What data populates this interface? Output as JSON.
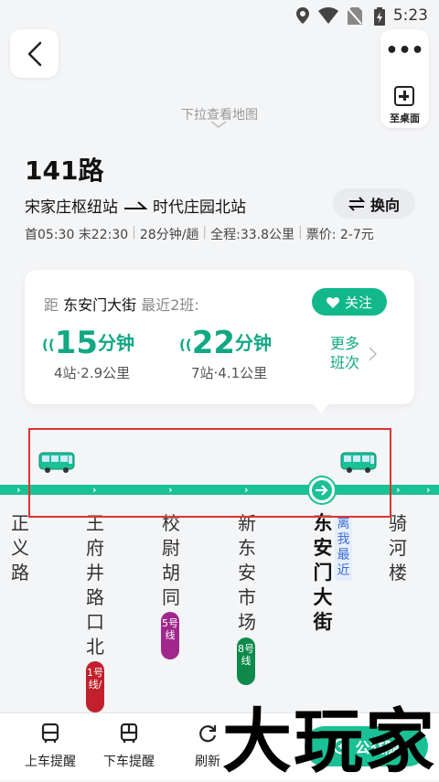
{
  "status_bar": {
    "time": "5:23"
  },
  "header": {
    "pull_hint": "下拉查看地图",
    "desktop_label": "至桌面"
  },
  "route": {
    "name": "141路",
    "from": "宋家庄枢纽站",
    "to": "时代庄园北站",
    "swap_label": "换向",
    "info": [
      "首05:30 末22:30",
      "28分钟/趟",
      "全程:33.8公里",
      "票价: 2-7元"
    ]
  },
  "arrival": {
    "prefix": "距",
    "station": "东安门大街",
    "suffix": "最近2班:",
    "follow_label": "关注",
    "buses": [
      {
        "minutes": "15",
        "unit": "分钟",
        "detail": "4站·2.9公里"
      },
      {
        "minutes": "22",
        "unit": "分钟",
        "detail": "7站·4.1公里"
      }
    ],
    "more_line1": "更多",
    "more_line2": "班次"
  },
  "stops": [
    {
      "name": "正义路"
    },
    {
      "name": "王府井路口北",
      "metro": {
        "label": "1号线/",
        "color": "#c2202c"
      }
    },
    {
      "name": "校尉胡同",
      "metro": {
        "label": "5号线",
        "color": "#a0288c"
      }
    },
    {
      "name": "新东安市场",
      "metro": {
        "label": "8号线",
        "color": "#0d8a4a"
      }
    },
    {
      "name": "东安门大街",
      "current": true,
      "tag": "离我最近"
    },
    {
      "name": "骑河楼"
    }
  ],
  "bottom": {
    "tools": [
      "上车提醒",
      "下车提醒",
      "刷新"
    ],
    "bus_button": "公交随"
  },
  "watermark": "大玩家",
  "colors": {
    "accent": "#19c195",
    "accent_dark": "#12a884",
    "highlight": "#e0332f"
  }
}
